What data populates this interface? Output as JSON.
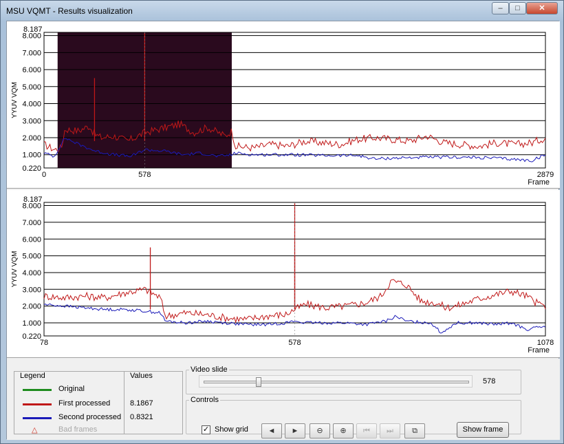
{
  "window": {
    "title": "MSU VQMT - Results visualization",
    "min_icon": "minimize-icon",
    "max_icon": "maximize-icon",
    "close_icon": "close-icon"
  },
  "colors": {
    "original": "#1e8c1e",
    "first": "#c01818",
    "second": "#1a1ab8",
    "selection": "#2a0a1e"
  },
  "chart_data": [
    {
      "type": "line",
      "ylabel": "YYUV VQM",
      "xlabel": "Frame",
      "ymax_label": "8.187",
      "ymin_label": "0.220",
      "ylim": [
        0.22,
        8.187
      ],
      "xlim": [
        0,
        2879
      ],
      "y_ticks": [
        "1.000",
        "2.000",
        "3.000",
        "4.000",
        "5.000",
        "6.000",
        "7.000",
        "8.000"
      ],
      "x_ticks": [
        "0",
        "578",
        "2879"
      ],
      "grid": true,
      "selection_range": [
        78,
        1078
      ],
      "cursor_frame": 578,
      "series": [
        {
          "name": "First processed",
          "key": "first",
          "peaks": [
            [
              290,
              5.5
            ],
            [
              578,
              8.15
            ]
          ],
          "points": [
            [
              0,
              1.6
            ],
            [
              60,
              1.3
            ],
            [
              100,
              1.4
            ],
            [
              120,
              2.5
            ],
            [
              200,
              2.4
            ],
            [
              260,
              2.7
            ],
            [
              290,
              2.2
            ],
            [
              330,
              2.0
            ],
            [
              400,
              2.1
            ],
            [
              480,
              1.8
            ],
            [
              520,
              2.0
            ],
            [
              578,
              2.3
            ],
            [
              620,
              2.4
            ],
            [
              700,
              2.6
            ],
            [
              780,
              2.8
            ],
            [
              860,
              2.3
            ],
            [
              940,
              2.6
            ],
            [
              1000,
              2.3
            ],
            [
              1040,
              2.1
            ],
            [
              1078,
              2.4
            ],
            [
              1100,
              1.5
            ],
            [
              1200,
              1.4
            ],
            [
              1300,
              1.6
            ],
            [
              1400,
              1.5
            ],
            [
              1500,
              1.8
            ],
            [
              1600,
              1.7
            ],
            [
              1700,
              1.6
            ],
            [
              1800,
              1.9
            ],
            [
              1900,
              2.0
            ],
            [
              2000,
              1.9
            ],
            [
              2100,
              1.8
            ],
            [
              2200,
              2.1
            ],
            [
              2300,
              1.7
            ],
            [
              2400,
              1.6
            ],
            [
              2500,
              1.5
            ],
            [
              2600,
              1.7
            ],
            [
              2700,
              1.6
            ],
            [
              2800,
              1.7
            ],
            [
              2879,
              2.0
            ]
          ]
        },
        {
          "name": "Second processed",
          "key": "second",
          "points": [
            [
              0,
              1.1
            ],
            [
              60,
              0.9
            ],
            [
              120,
              2.0
            ],
            [
              200,
              1.6
            ],
            [
              300,
              1.2
            ],
            [
              400,
              1.0
            ],
            [
              500,
              0.9
            ],
            [
              578,
              1.3
            ],
            [
              700,
              1.2
            ],
            [
              800,
              1.0
            ],
            [
              900,
              1.1
            ],
            [
              1000,
              0.9
            ],
            [
              1078,
              1.0
            ],
            [
              1100,
              1.1
            ],
            [
              1200,
              1.0
            ],
            [
              1400,
              1.0
            ],
            [
              1600,
              0.95
            ],
            [
              1800,
              0.95
            ],
            [
              1900,
              0.75
            ],
            [
              2000,
              0.8
            ],
            [
              2200,
              0.85
            ],
            [
              2400,
              0.85
            ],
            [
              2600,
              0.8
            ],
            [
              2800,
              0.65
            ],
            [
              2879,
              1.0
            ]
          ]
        }
      ]
    },
    {
      "type": "line",
      "ylabel": "YYUV VQM",
      "xlabel": "Frame",
      "ymax_label": "8.187",
      "ymin_label": "0.220",
      "ylim": [
        0.22,
        8.187
      ],
      "xlim": [
        78,
        1078
      ],
      "y_ticks": [
        "1.000",
        "2.000",
        "3.000",
        "4.000",
        "5.000",
        "6.000",
        "7.000",
        "8.000"
      ],
      "x_ticks": [
        "78",
        "578",
        "1078"
      ],
      "grid": true,
      "cursor_frame": 578,
      "series": [
        {
          "name": "First processed",
          "key": "first",
          "peaks": [
            [
              290,
              5.5
            ],
            [
              578,
              8.15
            ],
            [
              578,
              5.0
            ]
          ],
          "points": [
            [
              78,
              2.6
            ],
            [
              120,
              2.5
            ],
            [
              160,
              2.6
            ],
            [
              200,
              2.5
            ],
            [
              240,
              2.8
            ],
            [
              280,
              3.0
            ],
            [
              310,
              2.5
            ],
            [
              320,
              1.4
            ],
            [
              360,
              1.6
            ],
            [
              400,
              1.5
            ],
            [
              440,
              1.3
            ],
            [
              480,
              1.2
            ],
            [
              520,
              1.4
            ],
            [
              560,
              1.5
            ],
            [
              578,
              1.8
            ],
            [
              600,
              2.1
            ],
            [
              640,
              1.9
            ],
            [
              680,
              2.0
            ],
            [
              720,
              2.2
            ],
            [
              750,
              2.6
            ],
            [
              770,
              3.5
            ],
            [
              800,
              3.3
            ],
            [
              830,
              2.3
            ],
            [
              860,
              2.2
            ],
            [
              880,
              1.9
            ],
            [
              900,
              2.0
            ],
            [
              940,
              2.4
            ],
            [
              980,
              2.7
            ],
            [
              1010,
              2.9
            ],
            [
              1040,
              2.6
            ],
            [
              1060,
              2.2
            ],
            [
              1078,
              2.0
            ]
          ]
        },
        {
          "name": "Second processed",
          "key": "second",
          "points": [
            [
              78,
              2.1
            ],
            [
              120,
              2.0
            ],
            [
              160,
              1.9
            ],
            [
              200,
              1.8
            ],
            [
              240,
              1.8
            ],
            [
              280,
              1.7
            ],
            [
              310,
              1.6
            ],
            [
              320,
              1.1
            ],
            [
              360,
              1.0
            ],
            [
              400,
              1.1
            ],
            [
              440,
              1.0
            ],
            [
              480,
              0.9
            ],
            [
              520,
              0.9
            ],
            [
              560,
              1.0
            ],
            [
              578,
              1.1
            ],
            [
              600,
              1.0
            ],
            [
              640,
              1.0
            ],
            [
              680,
              1.0
            ],
            [
              720,
              0.9
            ],
            [
              760,
              1.1
            ],
            [
              780,
              1.4
            ],
            [
              800,
              1.1
            ],
            [
              850,
              1.0
            ],
            [
              870,
              0.4
            ],
            [
              900,
              1.0
            ],
            [
              940,
              1.0
            ],
            [
              980,
              0.9
            ],
            [
              1010,
              1.0
            ],
            [
              1040,
              0.6
            ],
            [
              1078,
              0.8
            ]
          ]
        }
      ]
    }
  ],
  "legend": {
    "title": "Legend",
    "values_title": "Values",
    "items": [
      {
        "label": "Original",
        "color_key": "original",
        "value": ""
      },
      {
        "label": "First processed",
        "color_key": "first",
        "value": "8.1867"
      },
      {
        "label": "Second processed",
        "color_key": "second",
        "value": "0.8321"
      }
    ],
    "bad_frames": "Bad frames"
  },
  "video_slide": {
    "title": "Video slide",
    "value": "578",
    "min": 0,
    "max": 2879,
    "current": 578
  },
  "controls": {
    "title": "Controls",
    "show_grid_label": "Show grid",
    "show_grid_checked": "✓",
    "buttons": [
      {
        "icon": "prev-arrow-icon",
        "glyph": "◄",
        "disabled": false
      },
      {
        "icon": "next-arrow-icon",
        "glyph": "►",
        "disabled": false
      },
      {
        "icon": "zoom-out-icon",
        "glyph": "⊖",
        "disabled": false
      },
      {
        "icon": "zoom-in-icon",
        "glyph": "⊕",
        "disabled": false
      },
      {
        "icon": "first-frame-icon",
        "glyph": "⏮",
        "disabled": true
      },
      {
        "icon": "last-frame-icon",
        "glyph": "⏭",
        "disabled": true
      },
      {
        "icon": "copy-icon",
        "glyph": "⧉",
        "disabled": false
      }
    ],
    "show_frame_label": "Show frame"
  }
}
